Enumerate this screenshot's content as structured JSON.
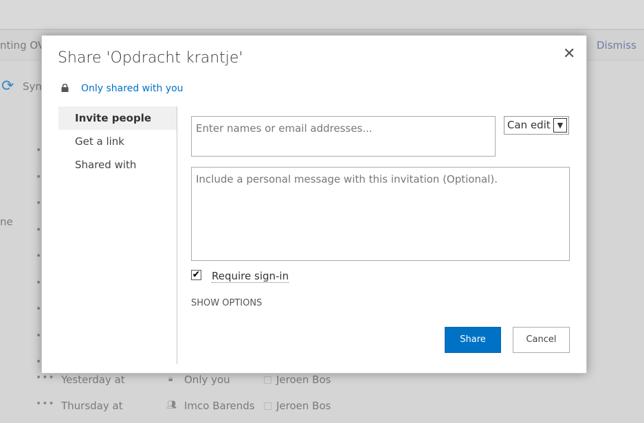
{
  "background": {
    "notice_left": "nting OV",
    "dismiss": "Dismiss",
    "sync": "Syn",
    "side_fragment": "ne",
    "rows": [
      {
        "modified": "Yesterday at",
        "sharing": "Only you",
        "sharing_icon": "lock-icon",
        "modified_by": "Jeroen Bos"
      },
      {
        "modified": "Thursday at",
        "sharing": "Imco Barends",
        "sharing_icon": "people-icon",
        "modified_by": "Jeroen Bos"
      }
    ]
  },
  "dialog": {
    "title": "Share 'Opdracht krantje'",
    "shared_status": "Only shared with you",
    "nav": [
      {
        "label": "Invite people",
        "selected": true
      },
      {
        "label": "Get a link"
      },
      {
        "label": "Shared with"
      }
    ],
    "names_placeholder": "Enter names or email addresses...",
    "permission": "Can edit",
    "message_placeholder": "Include a personal message with this invitation (Optional).",
    "require_signin": {
      "label": "Require sign-in",
      "checked": true
    },
    "show_options": "SHOW OPTIONS",
    "share_label": "Share",
    "cancel_label": "Cancel",
    "accent": "#0072c6"
  }
}
